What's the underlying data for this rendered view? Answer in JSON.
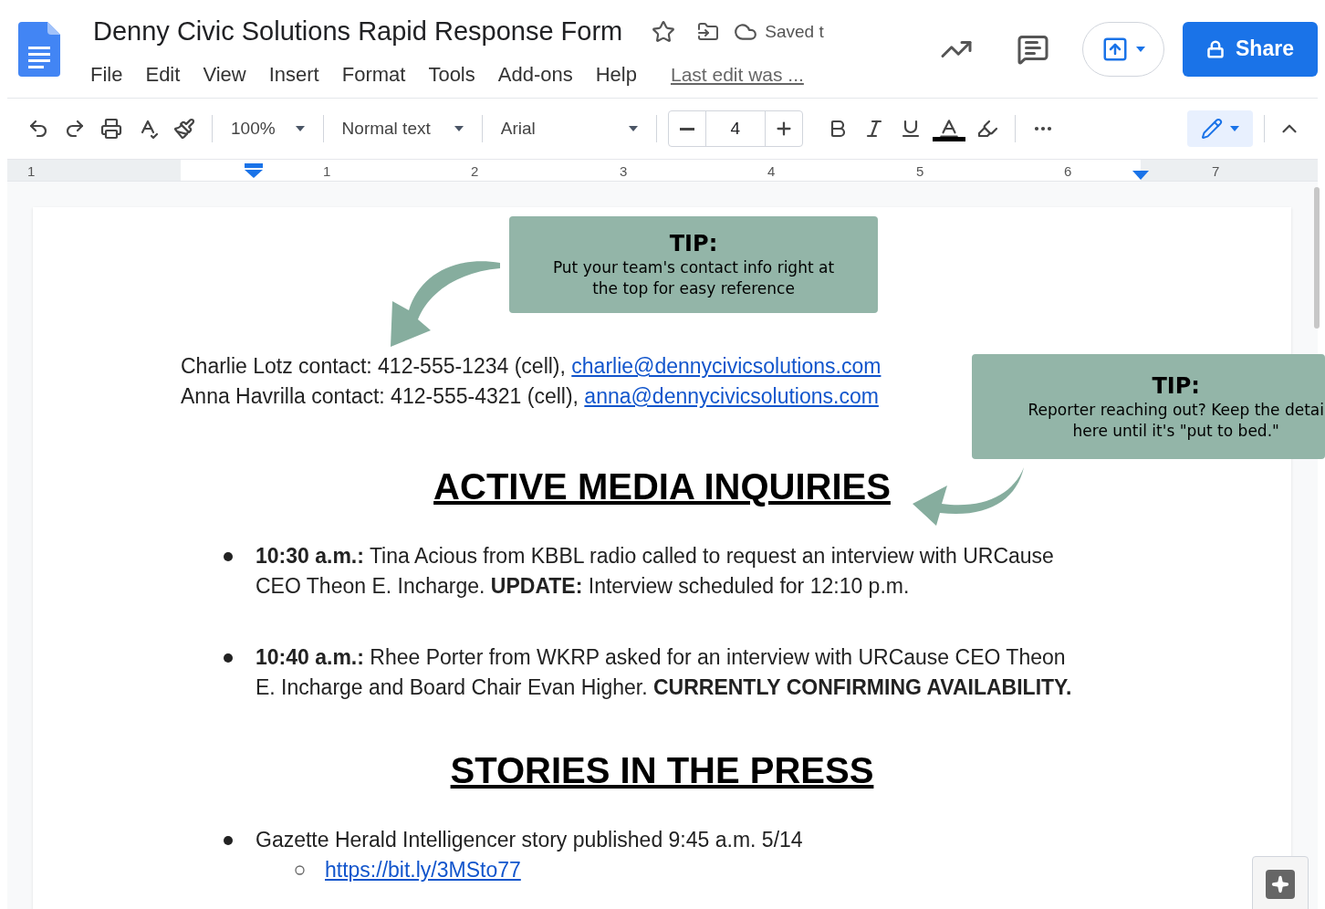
{
  "header": {
    "title": "Denny Civic Solutions Rapid Response Form",
    "saved_status": "Saved t",
    "menus": [
      "File",
      "Edit",
      "View",
      "Insert",
      "Format",
      "Tools",
      "Add-ons",
      "Help"
    ],
    "last_edit": "Last edit was ...",
    "share": "Share"
  },
  "toolbar": {
    "zoom": "100%",
    "style": "Normal text",
    "font": "Arial",
    "font_size": "4"
  },
  "ruler": [
    "1",
    "1",
    "2",
    "3",
    "4",
    "5",
    "6",
    "7"
  ],
  "contacts": [
    {
      "text": "Charlie Lotz contact: 412-555-1234 (cell), ",
      "email": "charlie@dennycivicsolutions.com"
    },
    {
      "text": "Anna Havrilla contact: 412-555-4321 (cell), ",
      "email": "anna@dennycivicsolutions.com"
    }
  ],
  "sections": [
    {
      "heading": "ACTIVE MEDIA INQUIRIES",
      "items": [
        {
          "text": "**10:30 a.m.:** Tina Acious from KBBL radio called to request an interview with URCause CEO Theon E. Incharge. **UPDATE:** Interview scheduled for 12:10 p.m."
        },
        {
          "text": "**10:40 a.m.:** Rhee Porter from WKRP asked for an interview with URCause CEO Theon E. Incharge and Board Chair Evan Higher. **CURRENTLY CONFIRMING AVAILABILITY.**"
        }
      ]
    },
    {
      "heading": "STORIES IN THE PRESS",
      "items": [
        {
          "text": "Gazette Herald Intelligencer story published 9:45 a.m. 5/14",
          "children": [
            {
              "link": "https://bit.ly/3MSto77"
            }
          ]
        }
      ]
    }
  ],
  "tips": [
    {
      "title": "TIP:",
      "lines": [
        "Put your team's contact info right at",
        "the top for easy reference"
      ]
    },
    {
      "title": "TIP:",
      "lines": [
        "Reporter reaching out? Keep the detai",
        "here until it's \"put to bed.\""
      ]
    }
  ]
}
